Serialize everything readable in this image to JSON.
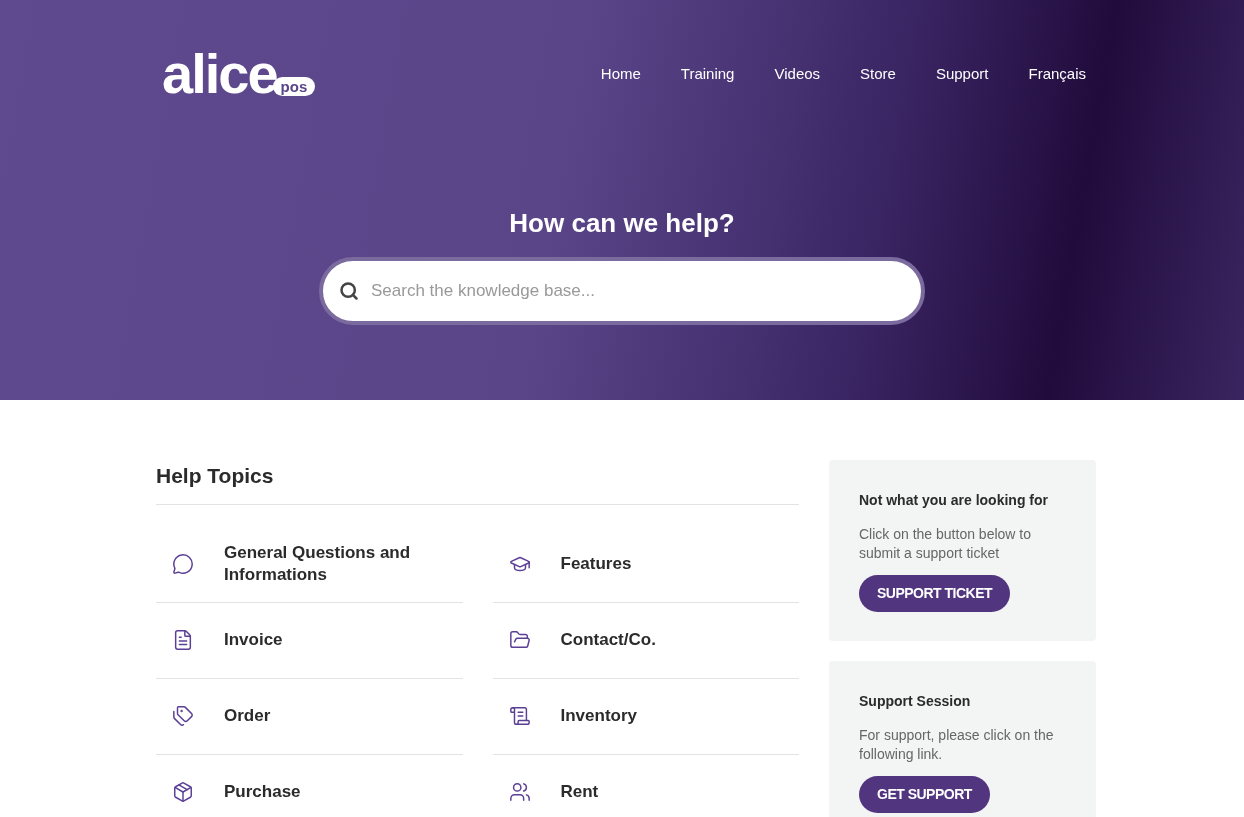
{
  "logo": {
    "name": "alice",
    "badge": "pos"
  },
  "nav": [
    {
      "label": "Home"
    },
    {
      "label": "Training"
    },
    {
      "label": "Videos"
    },
    {
      "label": "Store"
    },
    {
      "label": "Support"
    },
    {
      "label": "Français"
    }
  ],
  "hero": {
    "title": "How can we help?",
    "search": {
      "placeholder": "Search the knowledge base..."
    }
  },
  "help_topics": {
    "title": "Help Topics",
    "items": [
      {
        "label": "General Questions and Informations",
        "kind": "chat"
      },
      {
        "label": "Features",
        "kind": "graduation"
      },
      {
        "label": "Invoice",
        "kind": "document"
      },
      {
        "label": "Contact/Co.",
        "kind": "folder"
      },
      {
        "label": "Order",
        "kind": "tags"
      },
      {
        "label": "Inventory",
        "kind": "scroll"
      },
      {
        "label": "Purchase",
        "kind": "box"
      },
      {
        "label": "Rent",
        "kind": "people"
      }
    ]
  },
  "sidebar": [
    {
      "title": "Not what you are looking for",
      "text": "Click on the button below to submit a support ticket",
      "button": "SUPPORT TICKET"
    },
    {
      "title": "Support Session",
      "text": "For support, please click on the following link.",
      "button": "GET SUPPORT"
    }
  ]
}
